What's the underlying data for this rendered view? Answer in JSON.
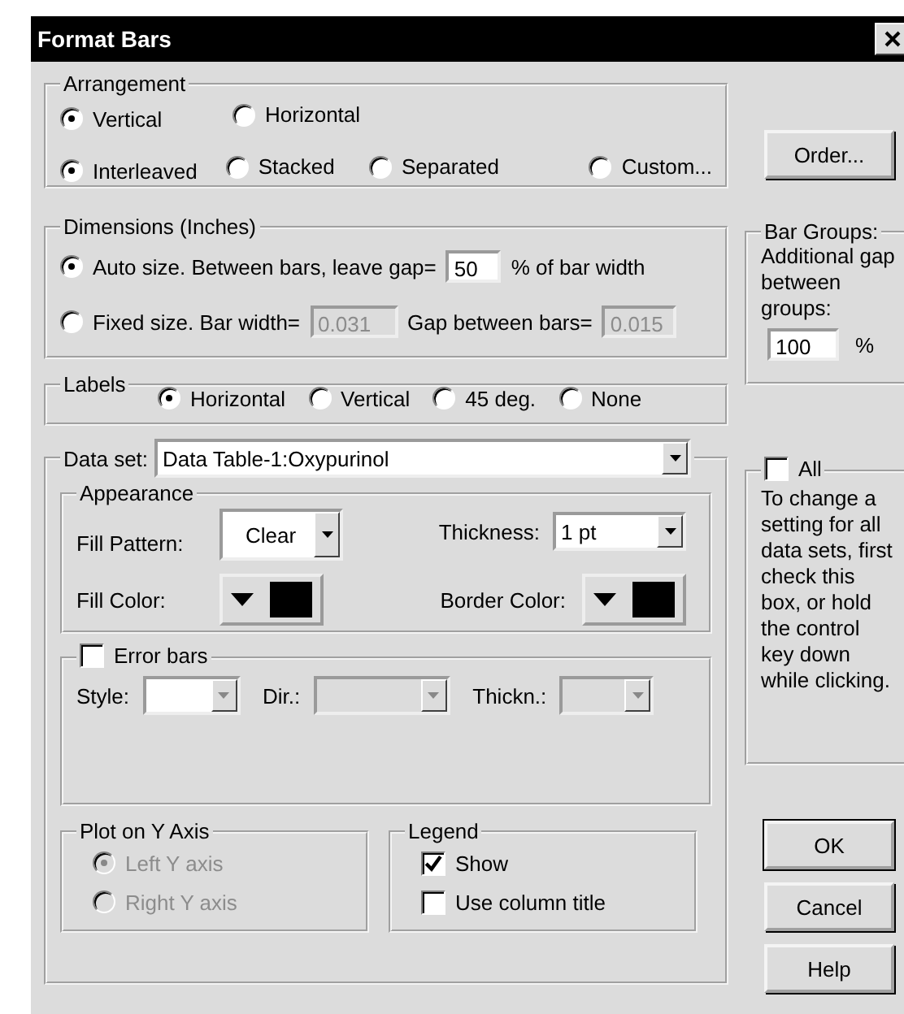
{
  "window": {
    "title": "Format Bars"
  },
  "arrangement": {
    "label": "Arrangement",
    "orientation": [
      {
        "label": "Vertical",
        "selected": true
      },
      {
        "label": "Horizontal",
        "selected": false
      }
    ],
    "layout": [
      {
        "label": "Interleaved",
        "selected": true
      },
      {
        "label": "Stacked",
        "selected": false
      },
      {
        "label": "Separated",
        "selected": false
      },
      {
        "label": "Custom...",
        "selected": false
      }
    ]
  },
  "order_button": "Order...",
  "dimensions": {
    "label": "Dimensions (Inches)",
    "auto": {
      "label": "Auto size. Between bars, leave gap=",
      "selected": true,
      "value": "50",
      "suffix": "% of bar width"
    },
    "fixed": {
      "label": "Fixed size. Bar width=",
      "selected": false,
      "value": "0.031",
      "gap_label": "Gap between bars=",
      "gap_value": "0.015",
      "disabled": true
    }
  },
  "bar_groups": {
    "label": "Bar Groups:",
    "description": "Additional gap between groups:",
    "value": "100",
    "suffix": "%"
  },
  "labels": {
    "label": "Labels",
    "options": [
      {
        "label": "Horizontal",
        "selected": true
      },
      {
        "label": "Vertical",
        "selected": false
      },
      {
        "label": "45 deg.",
        "selected": false
      },
      {
        "label": "None",
        "selected": false
      }
    ]
  },
  "data_set": {
    "label": "Data set:",
    "value": "Data Table-1:Oxypurinol",
    "appearance": {
      "label": "Appearance",
      "fill_pattern": {
        "label": "Fill Pattern:",
        "value": "Clear"
      },
      "thickness": {
        "label": "Thickness:",
        "value": "1 pt"
      },
      "fill_color": {
        "label": "Fill Color:",
        "color": "#000000"
      },
      "border_color": {
        "label": "Border Color:",
        "color": "#000000"
      }
    },
    "error_bars": {
      "label": "Error bars",
      "checked": false,
      "fields": [
        {
          "label": "Style:",
          "disabled": false
        },
        {
          "label": "Dir.:",
          "disabled": true
        },
        {
          "label": "Thickn.:",
          "disabled": true
        }
      ]
    },
    "plot_on_y_axis": {
      "label": "Plot on Y Axis",
      "disabled": true,
      "options": [
        {
          "label": "Left Y axis",
          "selected": true
        },
        {
          "label": "Right  Y axis",
          "selected": false
        }
      ]
    },
    "legend": {
      "label": "Legend",
      "options": [
        {
          "label": "Show",
          "checked": true
        },
        {
          "label": "Use column title",
          "checked": false
        }
      ]
    }
  },
  "all": {
    "label": "All",
    "checked": false,
    "description": "To change a setting for all data sets, first check this box, or hold the control key down while clicking."
  },
  "buttons": [
    {
      "label": "OK",
      "default": true
    },
    {
      "label": "Cancel",
      "default": false
    },
    {
      "label": "Help",
      "default": false
    }
  ]
}
